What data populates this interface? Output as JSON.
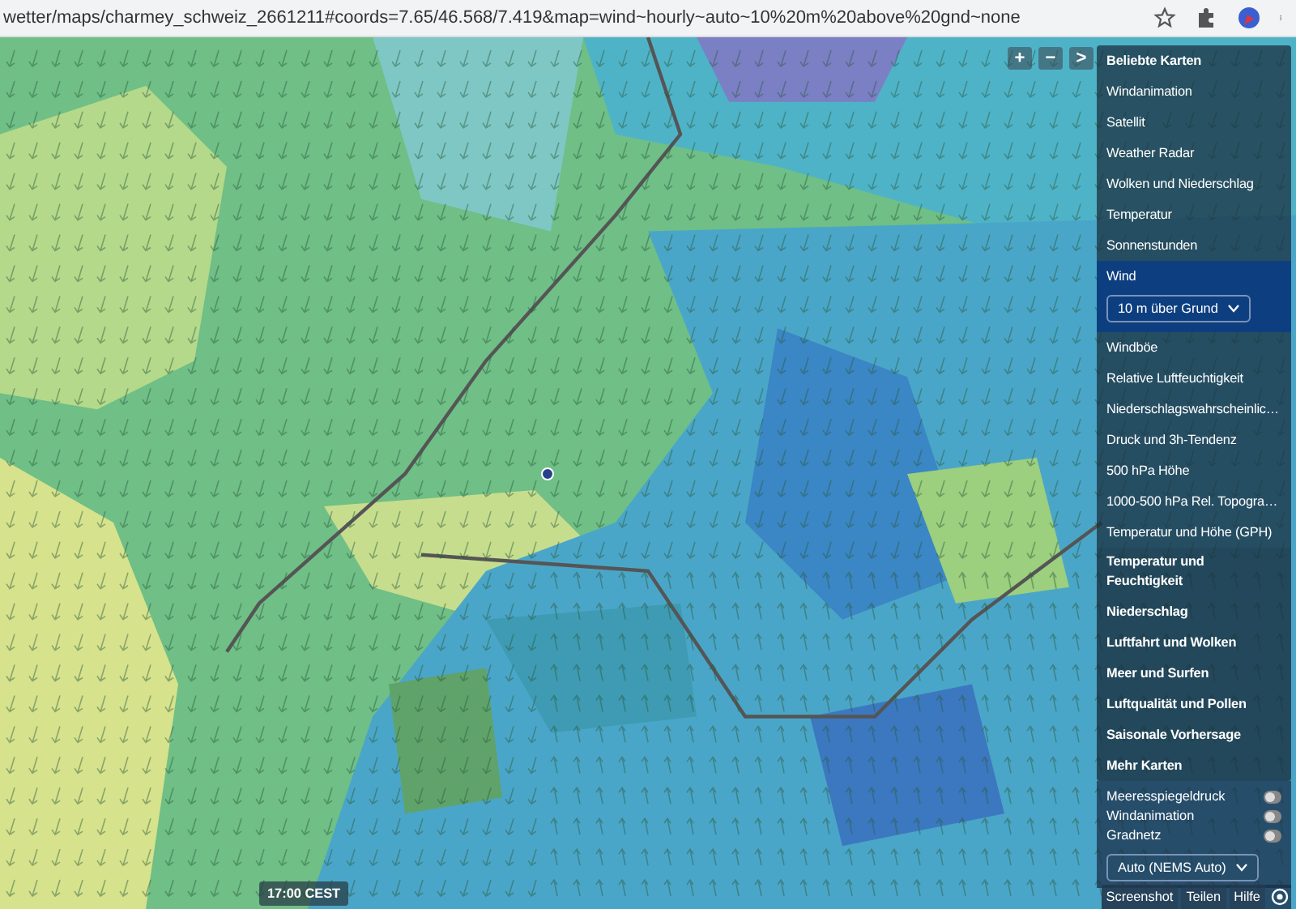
{
  "address_bar": {
    "url": "wetter/maps/charmey_schweiz_2661211#coords=7.65/46.568/7.419&map=wind~hourly~auto~10%20m%20above%20gnd~none"
  },
  "map": {
    "kind": "picture",
    "time": "17:00 CEST",
    "zoom_controls": [
      "+",
      "−",
      ">"
    ]
  },
  "menu": {
    "items": [
      {
        "label": "Beliebte Karten",
        "kind": "header",
        "selected": false
      },
      {
        "label": "Windanimation",
        "kind": "map",
        "selected": false
      },
      {
        "label": "Satellit",
        "kind": "map",
        "selected": false
      },
      {
        "label": "Weather Radar",
        "kind": "map",
        "selected": false
      },
      {
        "label": "Wolken und Niederschlag",
        "kind": "map",
        "selected": false
      },
      {
        "label": "Temperatur",
        "kind": "map",
        "selected": false
      },
      {
        "label": "Sonnenstunden",
        "kind": "map",
        "selected": false
      },
      {
        "label": "Wind",
        "kind": "map",
        "selected": true,
        "dropdown": "10 m über Grund"
      },
      {
        "label": "Windböe",
        "kind": "map",
        "selected": false
      },
      {
        "label": "Relative Luftfeuchtigkeit",
        "kind": "map",
        "selected": false
      },
      {
        "label": "Niederschlagswahrscheinlic…",
        "kind": "map",
        "selected": false
      },
      {
        "label": "Druck und 3h-Tendenz",
        "kind": "map",
        "selected": false
      },
      {
        "label": "500 hPa Höhe",
        "kind": "map",
        "selected": false
      },
      {
        "label": "1000-500 hPa Rel. Topogra…",
        "kind": "map",
        "selected": false
      },
      {
        "label": "Temperatur und Höhe (GPH)",
        "kind": "map",
        "selected": false
      },
      {
        "label": "Temperatur und Feuchtigkeit",
        "kind": "category",
        "selected": false
      },
      {
        "label": "Niederschlag",
        "kind": "category",
        "selected": false
      },
      {
        "label": "Luftfahrt und Wolken",
        "kind": "category",
        "selected": false
      },
      {
        "label": "Meer und Surfen",
        "kind": "category",
        "selected": false
      },
      {
        "label": "Luftqualität und Pollen",
        "kind": "category",
        "selected": false
      },
      {
        "label": "Saisonale Vorhersage",
        "kind": "category",
        "selected": false
      },
      {
        "label": "Mehr Karten",
        "kind": "category",
        "selected": false
      }
    ]
  },
  "layers": {
    "toggles": [
      {
        "label": "Meeresspiegeldruck",
        "on": false
      },
      {
        "label": "Windanimation",
        "on": false
      },
      {
        "label": "Gradnetz",
        "on": false
      }
    ],
    "model_select": "Auto (NEMS Auto)"
  },
  "footer_buttons": [
    "Screenshot",
    "Teilen",
    "Hilfe"
  ]
}
